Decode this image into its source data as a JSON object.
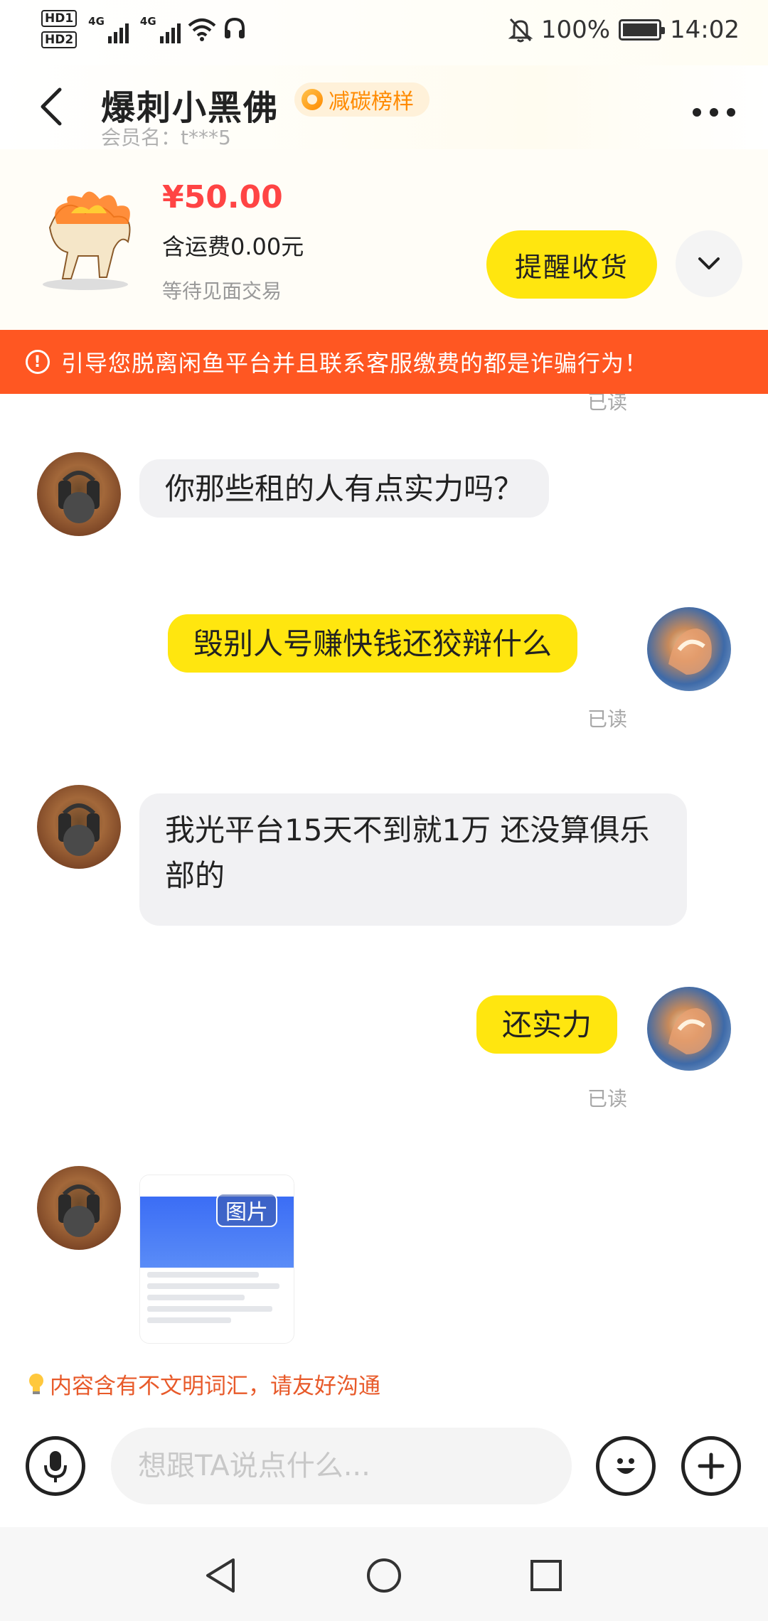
{
  "status_bar": {
    "hd1": "HD1",
    "hd2": "HD2",
    "net1": "4G",
    "net2": "4G",
    "battery": "100%",
    "time": "14:02",
    "icons": [
      "hd-icon",
      "signal-icon",
      "wifi-icon",
      "headset-icon",
      "mute-icon",
      "battery-icon"
    ]
  },
  "header": {
    "seller_name": "爆刺小黑佛",
    "badge": "减碳榜样",
    "member": "会员名：t***5"
  },
  "product": {
    "price": "¥50.00",
    "shipping": "含运费0.00元",
    "status": "等待见面交易",
    "remind_button": "提醒收货"
  },
  "warning": {
    "text": "引导您脱离闲鱼平台并且联系客服缴费的都是诈骗行为！",
    "color": "#ff5722"
  },
  "chat": {
    "read_label": "已读",
    "messages": [
      {
        "side": "in",
        "text": "你那些租的人有点实力吗？"
      },
      {
        "side": "out",
        "text": "毁别人号赚快钱还狡辩什么",
        "read": "已读"
      },
      {
        "side": "in",
        "text": "我光平台15天不到就1万 还没算俱乐部的"
      },
      {
        "side": "out",
        "text": "还实力",
        "read": "已读"
      },
      {
        "side": "in",
        "type": "image",
        "tag": "图片"
      }
    ]
  },
  "hint": {
    "text": "内容含有不文明词汇，请友好沟通",
    "color": "#e85a2a"
  },
  "input": {
    "placeholder": "想跟TA说点什么..."
  },
  "colors": {
    "accent_yellow": "#ffe60f",
    "price_red": "#ff4444",
    "badge_orange": "#ff8a00"
  }
}
